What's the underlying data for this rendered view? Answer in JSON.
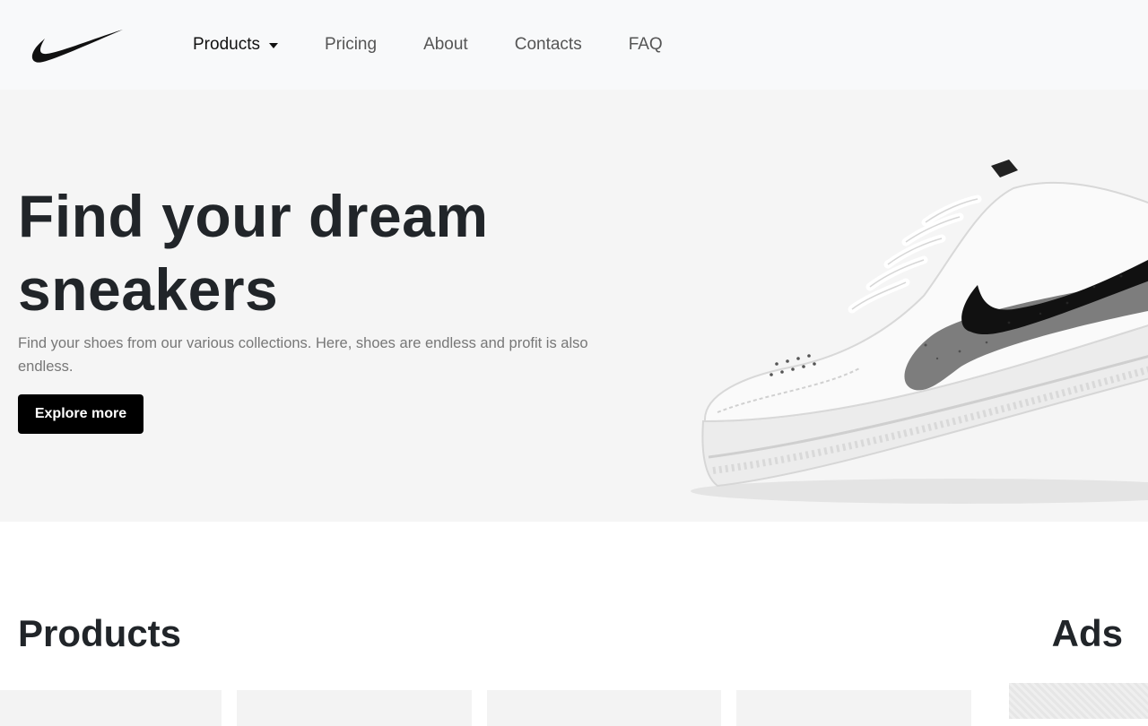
{
  "navbar": {
    "logo_icon": "swoosh-logo-icon",
    "items": [
      {
        "label": "Products",
        "active": true,
        "dropdown": true
      },
      {
        "label": "Pricing"
      },
      {
        "label": "About"
      },
      {
        "label": "Contacts"
      },
      {
        "label": "FAQ"
      }
    ]
  },
  "hero": {
    "title": "Find your dream sneakers",
    "description": "Find your shoes from our various collections. Here, shoes are endless and profit is also endless.",
    "button_label": "Explore more",
    "image_icon": "sneaker-image"
  },
  "products": {
    "title": "Products"
  },
  "ads": {
    "title": "Ads"
  },
  "colors": {
    "navbar_bg": "#f8f9fa",
    "hero_bg": "#f5f5f5",
    "button_bg": "#000000",
    "button_text": "#ffffff",
    "heading": "#212529",
    "muted_text": "#777777"
  }
}
